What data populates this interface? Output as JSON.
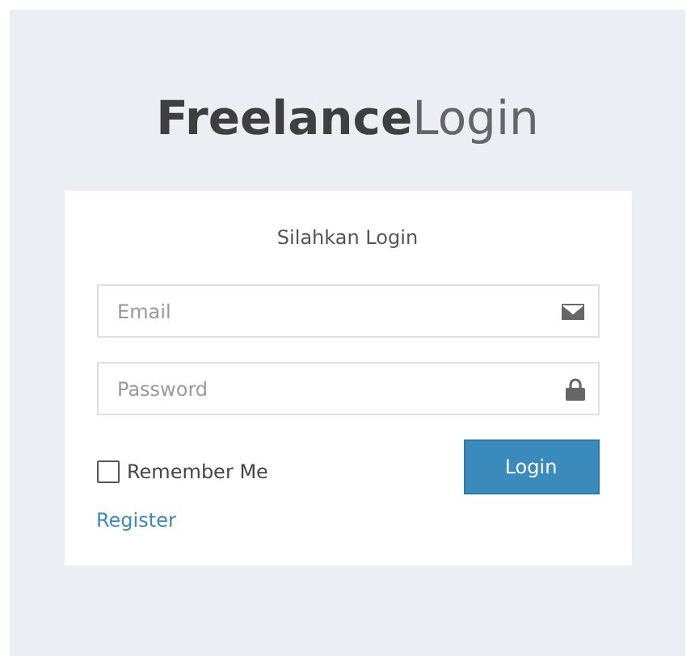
{
  "brand": {
    "title": "**Freelance**Login"
  },
  "card": {
    "heading": "Silahkan Login",
    "fields": [
      {
        "kind": "email",
        "placeholder": "Email"
      },
      {
        "kind": "password",
        "placeholder": "Password"
      }
    ],
    "remember": {
      "label": "Remember Me",
      "checked": false
    },
    "login_button": "Login",
    "register_link": "Register"
  }
}
